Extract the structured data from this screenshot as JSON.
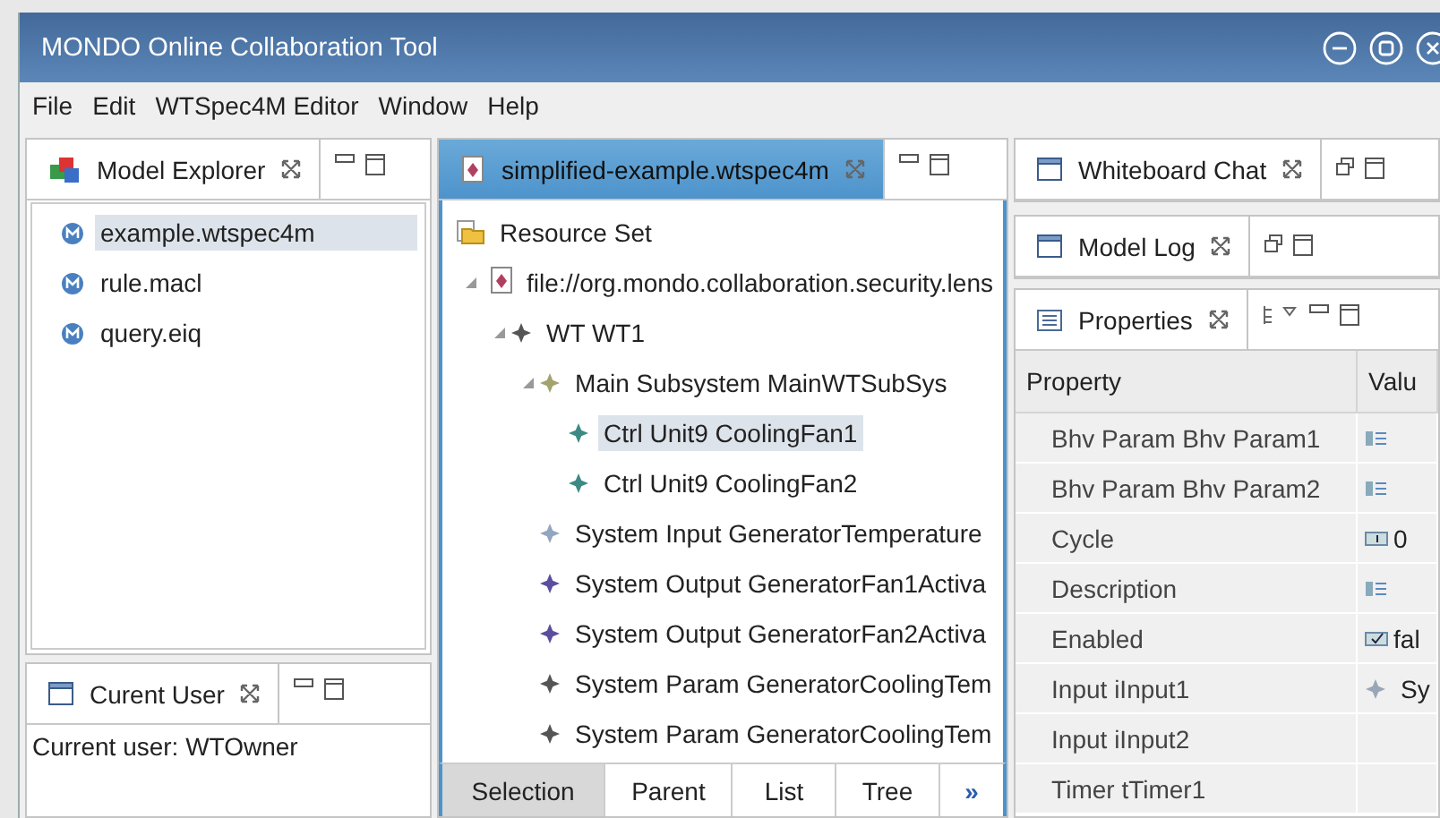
{
  "window": {
    "title": "MONDO Online Collaboration Tool"
  },
  "menu": [
    "File",
    "Edit",
    "WTSpec4M Editor",
    "Window",
    "Help"
  ],
  "model_explorer": {
    "tab": {
      "label": "Model Explorer",
      "selected": false
    },
    "items": [
      {
        "label": "example.wtspec4m",
        "selected": true
      },
      {
        "label": "rule.macl",
        "selected": false
      },
      {
        "label": "query.eiq",
        "selected": false
      }
    ]
  },
  "current_user": {
    "tab": {
      "label": "Curent User",
      "selected": false
    },
    "text": "Current user: WTOwner"
  },
  "editor": {
    "tab": {
      "label": "simplified-example.wtspec4m",
      "selected": true
    },
    "tree": {
      "label": "Resource Set",
      "kind": "resource-set",
      "selected": false,
      "children": [
        {
          "label": "file://org.mondo.collaboration.security.lens",
          "kind": "file",
          "selected": false,
          "expanded": true,
          "children": [
            {
              "label": "WT WT1",
              "kind": "element",
              "color": "#555555",
              "selected": false,
              "expanded": true,
              "children": [
                {
                  "label": "Main Subsystem MainWTSubSys",
                  "kind": "element",
                  "color": "#a3a36e",
                  "selected": false,
                  "expanded": true,
                  "children": [
                    {
                      "label": "Ctrl Unit9 CoolingFan1",
                      "kind": "element",
                      "color": "#3d8a84",
                      "selected": true
                    },
                    {
                      "label": "Ctrl Unit9 CoolingFan2",
                      "kind": "element",
                      "color": "#3d8a84",
                      "selected": false
                    }
                  ]
                },
                {
                  "label": "System Input GeneratorTemperature",
                  "kind": "element",
                  "color": "#93a6c0",
                  "selected": false
                },
                {
                  "label": "System Output GeneratorFan1Activa",
                  "kind": "element",
                  "color": "#5b4e9e",
                  "selected": false
                },
                {
                  "label": "System Output GeneratorFan2Activa",
                  "kind": "element",
                  "color": "#5b4e9e",
                  "selected": false
                },
                {
                  "label": "System Param GeneratorCoolingTem",
                  "kind": "element",
                  "color": "#555555",
                  "selected": false
                },
                {
                  "label": "System Param GeneratorCoolingTem",
                  "kind": "element",
                  "color": "#555555",
                  "selected": false
                }
              ]
            }
          ]
        }
      ]
    },
    "bottom_tabs": [
      {
        "label": "Selection",
        "selected": true
      },
      {
        "label": "Parent",
        "selected": false
      },
      {
        "label": "List",
        "selected": false
      },
      {
        "label": "Tree",
        "selected": false
      }
    ],
    "more": "»"
  },
  "whiteboard_chat": {
    "tab": {
      "label": "Whiteboard Chat",
      "selected": false
    }
  },
  "model_log": {
    "tab": {
      "label": "Model Log",
      "selected": false
    }
  },
  "properties": {
    "tab": {
      "label": "Properties",
      "selected": false
    },
    "columns": [
      "Property",
      "Valu"
    ],
    "rows": [
      {
        "property": "Bhv Param Bhv Param1",
        "kind": "text"
      },
      {
        "property": "Bhv Param Bhv Param2",
        "kind": "text"
      },
      {
        "property": "Cycle",
        "kind": "number",
        "value": "0"
      },
      {
        "property": "Description",
        "kind": "text"
      },
      {
        "property": "Enabled",
        "kind": "boolean",
        "value": "fal"
      },
      {
        "property": "Input iInput1",
        "kind": "element",
        "value": "Sy"
      },
      {
        "property": "Input iInput2",
        "kind": "empty"
      },
      {
        "property": "Timer tTimer1",
        "kind": "empty"
      }
    ]
  }
}
